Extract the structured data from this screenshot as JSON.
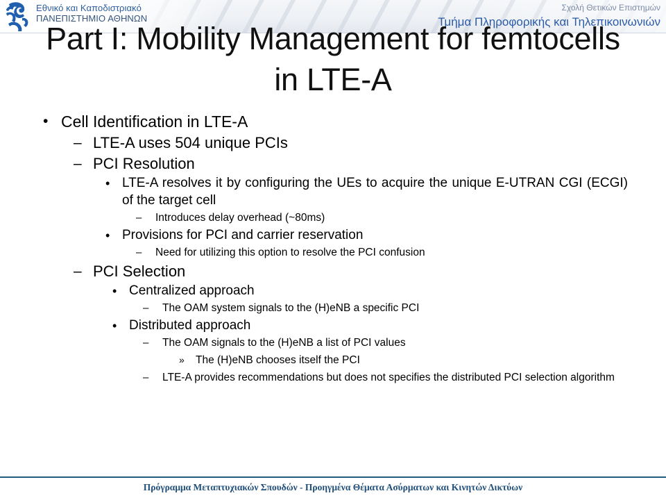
{
  "header": {
    "logo_alt": "university-emblem",
    "university_line1": "Εθνικό και Καποδιστριακό",
    "university_line2": "ΠΑΝΕΠΙΣΤΗΜΙΟ ΑΘΗΝΩΝ",
    "school": "Σχολή Θετικών Επιστημών",
    "department": "Τμήμα Πληροφορικής και Τηλεπικοινωνιών"
  },
  "slide": {
    "title": "Part I: Mobility Management for femtocells in LTE-A",
    "bullets": [
      {
        "level": 1,
        "marker": "•",
        "text": "Cell Identification in LTE-A"
      },
      {
        "level": 2,
        "marker": "–",
        "text": "LTE-A uses 504 unique PCIs"
      },
      {
        "level": 2,
        "marker": "–",
        "text": "PCI Resolution"
      },
      {
        "level": 3,
        "marker": "•",
        "text": "LTE-A resolves it by configuring the UEs to acquire the unique E-UTRAN CGI (ECGI) of the target cell"
      },
      {
        "level": 4,
        "marker": "–",
        "text": "Introduces delay overhead  (~80ms)"
      },
      {
        "level": 3,
        "marker": "•",
        "text": "Provisions for PCI and carrier reservation"
      },
      {
        "level": 4,
        "marker": "–",
        "text": "Need for utilizing this option to resolve the PCI confusion"
      },
      {
        "level": 2,
        "marker": "–",
        "text": "PCI Selection"
      },
      {
        "level": 3,
        "marker": "•",
        "text": "Centralized approach"
      },
      {
        "level": 4,
        "marker": "–",
        "text": "The OAM system signals to the (H)eNB a specific PCI"
      },
      {
        "level": 3,
        "marker": "•",
        "text": "Distributed approach"
      },
      {
        "level": 4,
        "marker": "–",
        "text": "The OAM signals to the (H)eNB a list of PCI values"
      },
      {
        "level": 5,
        "marker": "»",
        "text": "The (H)eNB chooses itself the PCI"
      },
      {
        "level": 4,
        "marker": "–",
        "text": "LTE-A provides recommendations but does not specifies the distributed PCI selection algorithm"
      }
    ]
  },
  "footer": {
    "text": "Πρόγραμμα Μεταπτυχιακών Σπουδών - Προηγμένα Θέματα Ασύρματων και Κινητών Δικτύων"
  },
  "colors": {
    "footer_rule": "#1f5c7e",
    "footer_text": "#1f4e79",
    "department_blue": "#2a5ba8",
    "school_gray": "#7c8ca6",
    "university_blue": "#2d5f9e"
  }
}
